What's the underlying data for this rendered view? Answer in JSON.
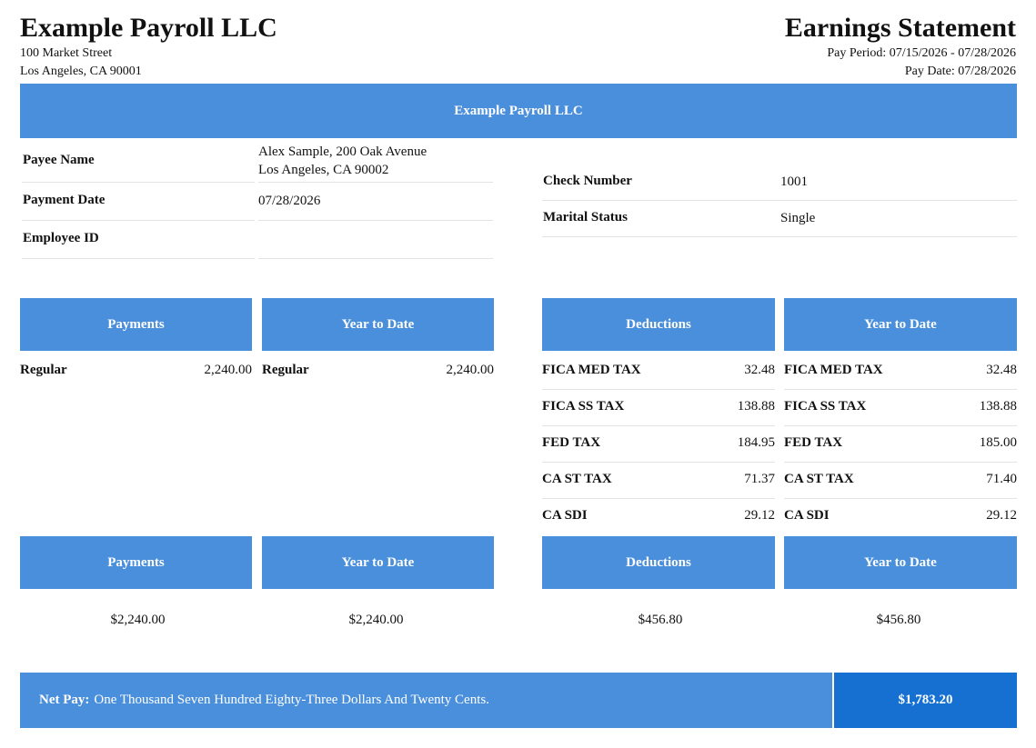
{
  "company": {
    "name": "Example Payroll LLC",
    "address_line1": "100 Market Street",
    "address_line2": "Los Angeles, CA 90001"
  },
  "statement": {
    "title": "Earnings Statement",
    "pay_period": "Pay Period: 07/15/2026 - 07/28/2026",
    "pay_date": "Pay Date: 07/28/2026"
  },
  "banner": {
    "title": "Example Payroll LLC"
  },
  "payee": {
    "name_label": "Payee Name",
    "name_line1": "Alex Sample, 200 Oak Avenue",
    "name_line2": "Los Angeles, CA 90002",
    "payment_date_label": "Payment Date",
    "payment_date": "07/28/2026",
    "employee_id_label": "Employee ID",
    "employee_id": "",
    "check_number_label": "Check Number",
    "check_number": "1001",
    "marital_status_label": "Marital Status",
    "marital_status": "Single"
  },
  "payments": {
    "header": "Payments",
    "ytd_header": "Year to Date",
    "rows": [
      {
        "label": "Regular",
        "amount": "2,240.00",
        "ytd_label": "Regular",
        "ytd_amount": "2,240.00"
      }
    ]
  },
  "deductions": {
    "header": "Deductions",
    "ytd_header": "Year to Date",
    "rows": [
      {
        "label": "FICA MED TAX",
        "amount": "32.48",
        "ytd_label": "FICA MED TAX",
        "ytd_amount": "32.48"
      },
      {
        "label": "FICA SS TAX",
        "amount": "138.88",
        "ytd_label": "FICA SS TAX",
        "ytd_amount": "138.88"
      },
      {
        "label": "FED TAX",
        "amount": "184.95",
        "ytd_label": "FED TAX",
        "ytd_amount": "185.00"
      },
      {
        "label": "CA ST TAX",
        "amount": "71.37",
        "ytd_label": "CA ST TAX",
        "ytd_amount": "71.40"
      },
      {
        "label": "CA SDI",
        "amount": "29.12",
        "ytd_label": "CA SDI",
        "ytd_amount": "29.12"
      }
    ]
  },
  "totals": {
    "payments_header": "Payments",
    "payments_ytd_header": "Year to Date",
    "deductions_header": "Deductions",
    "deductions_ytd_header": "Year to Date",
    "payments": "$2,240.00",
    "payments_ytd": "$2,240.00",
    "deductions": "$456.80",
    "deductions_ytd": "$456.80"
  },
  "net_pay": {
    "label": "Net Pay:",
    "words": "One Thousand Seven Hundred Eighty-Three Dollars And Twenty Cents.",
    "amount": "$1,783.20"
  },
  "colors": {
    "header_blue": "#4a8fdb",
    "net_amount_blue": "#1670d1"
  }
}
